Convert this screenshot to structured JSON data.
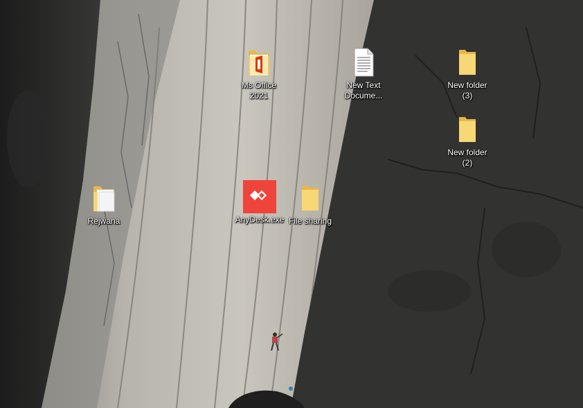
{
  "desktop": {
    "icons": [
      {
        "id": "ms-office",
        "label_line1": "Ms Office",
        "label_line2": "2021",
        "icon": "office-folder-icon"
      },
      {
        "id": "new-text",
        "label_line1": "New Text",
        "label_line2": "Docume...",
        "icon": "text-document-icon"
      },
      {
        "id": "new-folder-3",
        "label_line1": "New folder",
        "label_line2": "(3)",
        "icon": "folder-icon"
      },
      {
        "id": "new-folder-2",
        "label_line1": "New folder",
        "label_line2": "(2)",
        "icon": "folder-icon"
      },
      {
        "id": "rejwana",
        "label_line1": "Rejwana",
        "label_line2": "",
        "icon": "folder-with-documents-icon"
      },
      {
        "id": "anydesk",
        "label_line1": "AnyDesk.exe",
        "label_line2": "",
        "icon": "anydesk-icon"
      },
      {
        "id": "file-sharing",
        "label_line1": "File sharing",
        "label_line2": "",
        "icon": "folder-icon"
      }
    ]
  },
  "colors": {
    "folder_yellow": "#f8d775",
    "folder_dark": "#e6b84c",
    "anydesk_red": "#ef443b",
    "office_orange": "#d83b01"
  }
}
